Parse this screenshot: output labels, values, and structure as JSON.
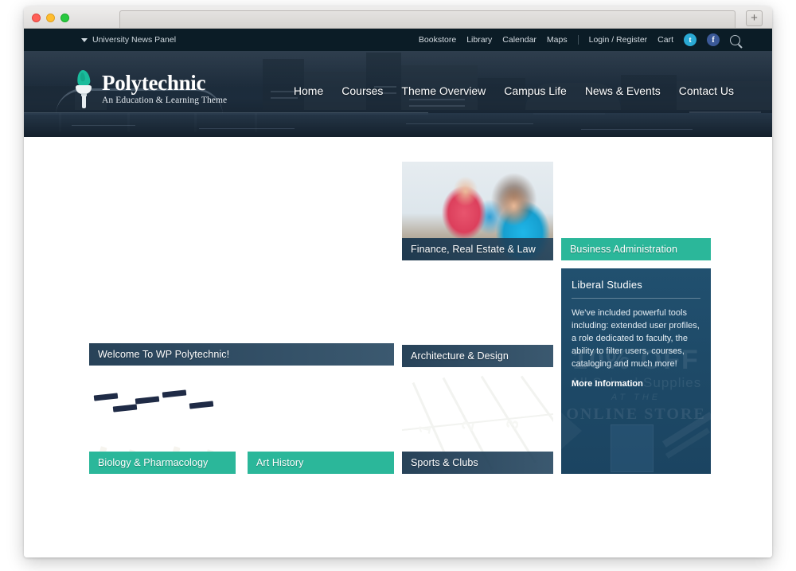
{
  "browser": {
    "window_controls": [
      "close",
      "minimize",
      "zoom"
    ],
    "new_tab_label": "+"
  },
  "topbar": {
    "panel_toggle_label": "University News Panel",
    "links": [
      "Bookstore",
      "Library",
      "Calendar",
      "Maps"
    ],
    "account_links": [
      "Login / Register",
      "Cart"
    ],
    "social": [
      {
        "name": "twitter",
        "glyph": "t",
        "color": "#2aa9d4"
      },
      {
        "name": "facebook",
        "glyph": "f",
        "color": "#3b5998"
      }
    ],
    "search_icon": "search-icon",
    "background_color": "#0b1c26"
  },
  "header": {
    "brand_name": "Polytechnic",
    "brand_tagline": "An Education & Learning Theme",
    "logo_icon": "torch-icon",
    "logo_flame_color": "#1abc9c",
    "background_color": "#22303f",
    "nav": [
      "Home",
      "Courses",
      "Theme Overview",
      "Campus Life",
      "News & Events",
      "Contact Us"
    ]
  },
  "grid": {
    "accent_teal": "#2bb79a",
    "accent_navy": "#17344c",
    "cards": [
      {
        "id": "hero",
        "caption": "Welcome To WP Polytechnic!",
        "caption_style": "navy"
      },
      {
        "id": "biology",
        "caption": "Biology & Pharmacology",
        "caption_style": "teal"
      },
      {
        "id": "arthistory",
        "caption": "Art History",
        "caption_style": "teal"
      },
      {
        "id": "finance",
        "caption": "Finance, Real Estate & Law",
        "caption_style": "navy"
      },
      {
        "id": "architecture",
        "caption": "Architecture & Design",
        "caption_style": "navy"
      },
      {
        "id": "sports",
        "caption": "Sports & Clubs",
        "caption_style": "navy"
      },
      {
        "id": "business",
        "caption": "Business Administration",
        "caption_style": "teal"
      }
    ],
    "track_lane_numbers": [
      "1",
      "2",
      "3"
    ]
  },
  "liberal_studies": {
    "title": "Liberal Studies",
    "body": "We've included powerful tools including: extended user profiles, a role dedicated to  faculty, the ability to filter users, courses, cataloging and much more!",
    "link_label": "More Information",
    "background_color": "#1f4c6b",
    "ghost_banner": {
      "line1": "10% OFF",
      "line2": "All School Supplies",
      "line3": "AT THE",
      "line4": "ONLINE STORE"
    }
  }
}
